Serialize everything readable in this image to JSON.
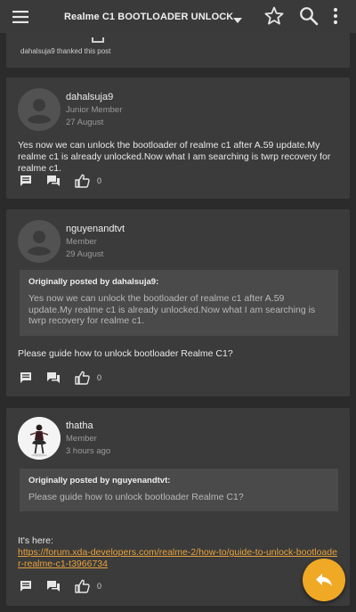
{
  "appbar": {
    "title": "Realme C1 BOOTLOADER UNLOCK",
    "icons": [
      "hamburger-menu-icon",
      "dropdown-caret-icon",
      "star-icon",
      "search-icon",
      "more-vert-icon"
    ]
  },
  "posts": [
    {
      "thanked_text": "dahalsuja9 thanked this post"
    },
    {
      "username": "dahalsuja9",
      "rank": "Junior Member",
      "date": "27 August",
      "body": "Yes now we can unlock the bootloader of realme c1 after A.59 update.My realme c1 is already unlocked.Now what I am searching is twrp recovery for realme c1.",
      "like_count": "0"
    },
    {
      "username": "nguyenandtvt",
      "rank": "Member",
      "date": "29 August",
      "quote_header": "Originally posted by dahalsuja9:",
      "quote_text": "Yes now we can unlock the bootloader of realme c1 after A.59 update.My realme c1 is already unlocked.Now what I am searching is twrp recovery for realme c1.",
      "body": "Please guide how to unlock bootloader Realme C1?",
      "like_count": "0"
    },
    {
      "username": "thatha",
      "rank": "Member",
      "date": "3 hours ago",
      "quote_header": "Originally posted by nguyenandtvt:",
      "quote_text": "Please guide how to unlock bootloader Realme C1?",
      "body_prefix": "It's here:",
      "link": "https://forum.xda-developers.com/realme-2/how-to/guide-to-unlock-bootloader-realme-c1-t3966734",
      "like_count": "0"
    }
  ],
  "colors": {
    "background": "#2b2b2b",
    "card": "#3b3b3b",
    "appbar": "#3a3a3a",
    "quote": "#4a4a4a",
    "accent": "#f0a925",
    "link": "#e8a33c"
  }
}
